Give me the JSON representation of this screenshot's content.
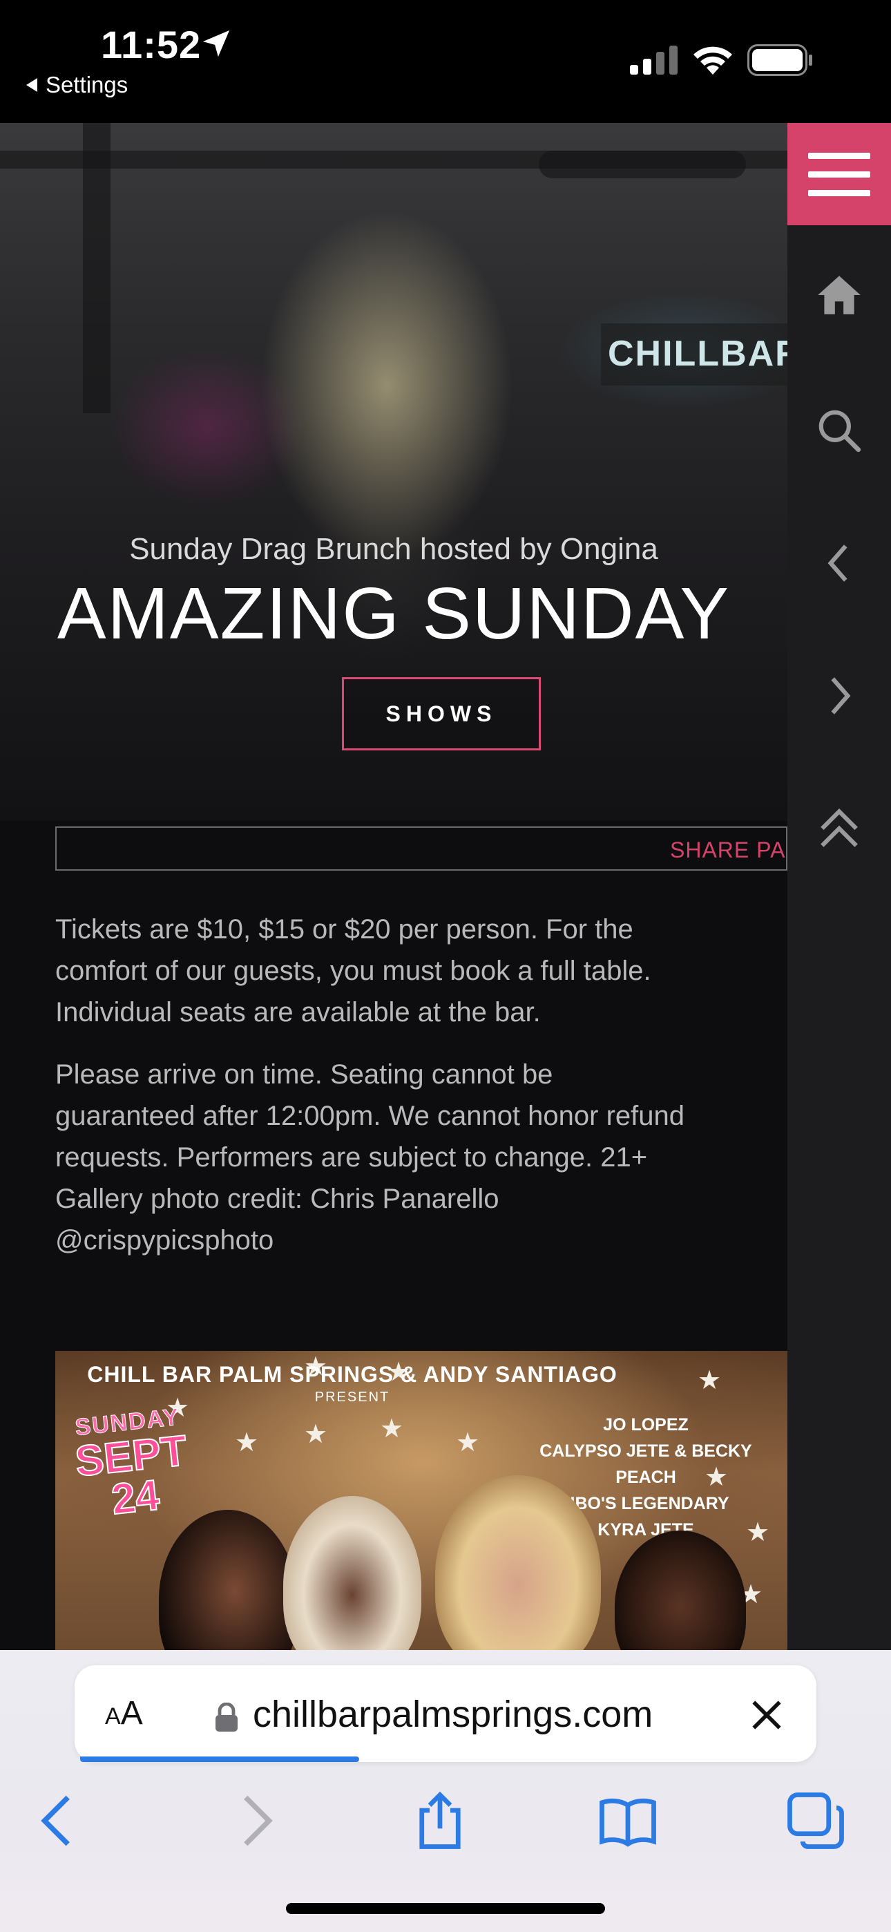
{
  "status_bar": {
    "time": "11:52",
    "back_app_label": "Settings",
    "icons": [
      "location-arrow-icon",
      "cellular-signal-icon",
      "wifi-icon",
      "battery-icon"
    ]
  },
  "hero": {
    "subtitle": "Sunday Drag Brunch hosted by Ongina",
    "title": "AMAZING SUNDAY",
    "shows_button": "SHOWS"
  },
  "side_nav": {
    "items": [
      "menu-icon",
      "home-icon",
      "search-icon",
      "chevron-left-icon",
      "chevron-right-icon",
      "double-chevron-up-icon"
    ]
  },
  "share": {
    "label": "SHARE PAGE"
  },
  "content": {
    "para1": [
      "Tickets are $10, $15 or $20 per person. For the",
      "comfort of our guests, you must book a full table.",
      "Individual seats are available at the bar."
    ],
    "para2": [
      "Please arrive on time. Seating cannot be",
      "guaranteed after 12:00pm. We cannot honor refund",
      "requests. Performers are subject to change.  21+",
      "Gallery photo credit: Chris Panarello",
      "@crispypicsphoto"
    ]
  },
  "poster": {
    "header": "CHILL BAR PALM SPRINGS & ANDY SANTIAGO",
    "present": "PRESENT",
    "date_day": "SUNDAY",
    "date_month": "SEPT",
    "date_num": "24",
    "lineup": [
      "JO LOPEZ",
      "CALYPSO JETE & BECKY PEACH",
      "HBO'S LEGENDARY",
      "KYRA JETE"
    ]
  },
  "browser": {
    "text_size_small": "A",
    "text_size_large": "A",
    "url": "chillbarpalmsprings.com",
    "toolbar": [
      "back-icon",
      "forward-icon",
      "share-icon",
      "bookmarks-icon",
      "tabs-icon"
    ],
    "accent_color": "#2c7be5"
  },
  "colors": {
    "brand_pink": "#d6436a",
    "background": "#0d0d0f",
    "body_text": "#b9b9b9"
  }
}
